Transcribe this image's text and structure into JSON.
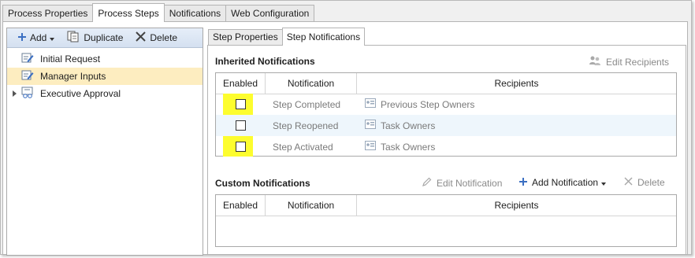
{
  "top_tabs": [
    {
      "label": "Process Properties",
      "active": false
    },
    {
      "label": "Process Steps",
      "active": true
    },
    {
      "label": "Notifications",
      "active": false
    },
    {
      "label": "Web Configuration",
      "active": false
    }
  ],
  "left_toolbar": {
    "add": "Add",
    "duplicate": "Duplicate",
    "delete": "Delete"
  },
  "tree": [
    {
      "label": "Initial Request",
      "selected": false
    },
    {
      "label": "Manager Inputs",
      "selected": true
    },
    {
      "label": "Executive Approval",
      "selected": false,
      "expandable": true
    }
  ],
  "sub_tabs": [
    {
      "label": "Step Properties",
      "active": false
    },
    {
      "label": "Step Notifications",
      "active": true
    }
  ],
  "inherited": {
    "title": "Inherited Notifications",
    "edit_recipients": "Edit Recipients",
    "columns": [
      "Enabled",
      "Notification",
      "Recipients"
    ],
    "rows": [
      {
        "notification": "Step Completed",
        "recipients": "Previous Step Owners",
        "enabled": false
      },
      {
        "notification": "Step Reopened",
        "recipients": "Task Owners",
        "enabled": false
      },
      {
        "notification": "Step Activated",
        "recipients": "Task Owners",
        "enabled": false
      }
    ]
  },
  "custom": {
    "title": "Custom Notifications",
    "edit_notification": "Edit Notification",
    "add_notification": "Add Notification",
    "delete": "Delete",
    "columns": [
      "Enabled",
      "Notification",
      "Recipients"
    ]
  },
  "colors": {
    "highlight": "#fdfd2e",
    "selected_row": "#fdedc0",
    "accent_blue": "#3b6fc2"
  }
}
